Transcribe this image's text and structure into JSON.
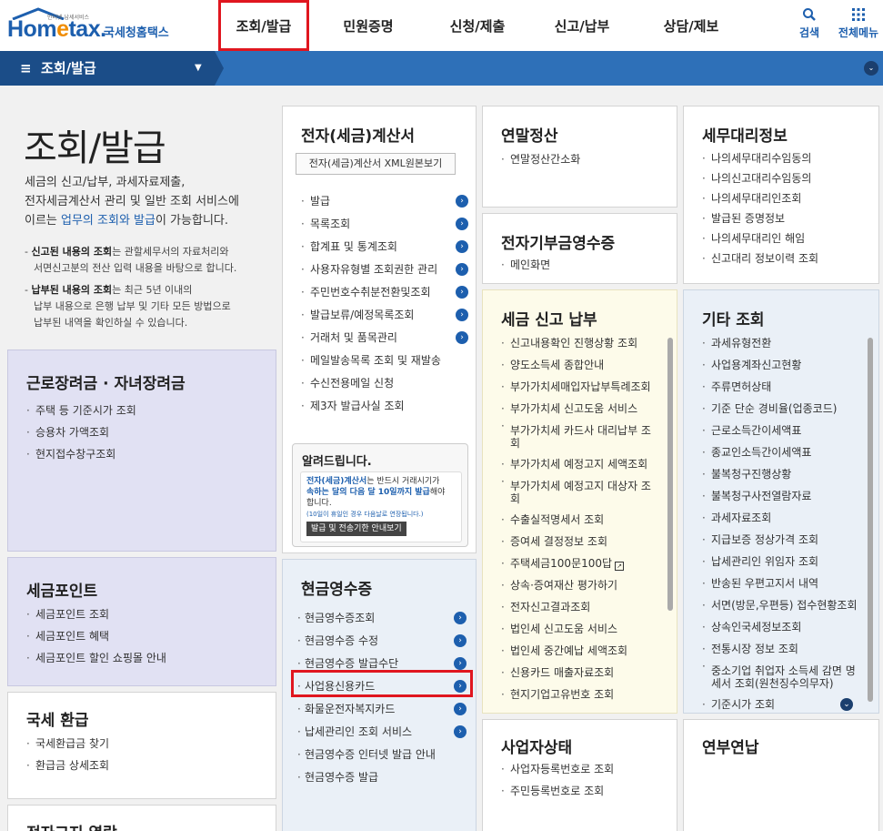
{
  "header": {
    "logo_tiny": "인터넷 납세서비스",
    "logo_word_a": "Hom",
    "logo_word_e": "e",
    "logo_word_b": "tax.",
    "logo_sub": "국세청홈택스",
    "gnb": [
      "조회/발급",
      "민원증명",
      "신청/제출",
      "신고/납부",
      "상담/제보"
    ],
    "search_label": "검색",
    "menu_label": "전체메뉴"
  },
  "navbar": {
    "title": "조회/발급",
    "menu_icon": "hamburger-icon"
  },
  "intro": {
    "title": "조회/발급",
    "desc_a": "세금의 신고/납부, 과세자료제출,",
    "desc_b": "전자세금계산서 관리 및 일반 조회 서비스에",
    "desc_c_pre": "이르는 ",
    "desc_c_hl": "업무의 조회와 발급",
    "desc_c_post": "이 가능합니다.",
    "note1_b": "신고된 내용의 조회",
    "note1_a": "는 관할세무서의 자료처리와",
    "note1_c": "서면신고분의 전산 입력 내용을 바탕으로 합니다.",
    "note2_b": "납부된 내용의 조회",
    "note2_a": "는 최근 5년 이내의",
    "note2_c": "납부 내용으로 은행 납부 및 기타 모든 방법으로",
    "note2_d": "납부된 내역을 확인하실 수 있습니다."
  },
  "cards": {
    "labor": {
      "title": "근로장려금 · 자녀장려금",
      "items": [
        "주택 등 기준시가 조회",
        "승용차 가액조회",
        "현지접수창구조회"
      ]
    },
    "point": {
      "title": "세금포인트",
      "items": [
        "세금포인트 조회",
        "세금포인트 혜택",
        "세금포인트 할인 쇼핑몰 안내"
      ]
    },
    "refund": {
      "title": "국세 환급",
      "items": [
        "국세환급금 찾기",
        "환급금 상세조회"
      ]
    },
    "notice_bottom": {
      "title": "전자고지 열람"
    },
    "einvoice": {
      "title": "전자(세금)계산서",
      "xml_button": "전자(세금)계산서 XML원본보기",
      "items": [
        "발급",
        "목록조회",
        "합계표 및 통계조회",
        "사용자유형별 조회권한 관리",
        "주민번호수취분전환및조회",
        "발급보류/예정목록조회",
        "거래처 및 품목관리",
        "메일발송목록 조회 및 재발송",
        "수신전용메일 신청",
        "제3자 발급사실 조회"
      ],
      "arrows": [
        true,
        true,
        true,
        true,
        true,
        true,
        true,
        false,
        false,
        false
      ]
    },
    "notice": {
      "title": "알려드립니다.",
      "text_a": "전자(세금)계산서",
      "text_b": "는 반드시 거래시기가",
      "text_c": "속하는 달의 다음 달 10일까지 발급",
      "text_d": "해야",
      "text_e": "합니다.",
      "text_small": "(10일이 휴일인 경우 다음날로 연장됩니다.)",
      "button": "발급 및 전송기한 안내보기"
    },
    "cash": {
      "title": "현금영수증",
      "items": [
        "현금영수증조회",
        "현금영수증 수정",
        "현금영수증 발급수단",
        "사업용신용카드",
        "화물운전자복지카드",
        "납세관리인 조회 서비스",
        "현금영수증 인터넷 발급 안내",
        "현금영수증 발급"
      ],
      "arrows": [
        true,
        true,
        true,
        true,
        true,
        true,
        false,
        false
      ]
    },
    "yearend": {
      "title": "연말정산",
      "items": [
        "연말정산간소화"
      ]
    },
    "donation": {
      "title": "전자기부금영수증",
      "items": [
        "메인화면"
      ]
    },
    "taxfile": {
      "title": "세금 신고 납부",
      "items": [
        "신고내용확인 진행상황 조회",
        "양도소득세 종합안내",
        "부가가치세매입자납부특례조회",
        "부가가치세 신고도움 서비스",
        "부가가치세 카드사 대리납부 조",
        "회",
        "부가가치세 예정고지 세액조회",
        "부가가치세 예정고지 대상자 조",
        "회",
        "수출실적명세서 조회",
        "증여세 결정정보 조회",
        "주택세금100문100답",
        "상속·증여재산 평가하기",
        "전자신고결과조회",
        "법인세 신고도움 서비스",
        "법인세 중간예납 세액조회",
        "신용카드 매출자료조회",
        "현지기업고유번호 조회"
      ]
    },
    "bizstatus": {
      "title": "사업자상태",
      "items": [
        "사업자등록번호로 조회",
        "주민등록번호로 조회"
      ]
    },
    "agent": {
      "title": "세무대리정보",
      "items": [
        "나의세무대리수임동의",
        "나의신고대리수임동의",
        "나의세무대리인조회",
        "발급된 증명정보",
        "나의세무대리인 해임",
        "신고대리 정보이력 조회"
      ]
    },
    "etc": {
      "title": "기타 조회",
      "items": [
        "과세유형전환",
        "사업용계좌신고현황",
        "주류면허상태",
        "기준 단순 경비율(업종코드)",
        "근로소득간이세액표",
        "종교인소득간이세액표",
        "불복청구진행상황",
        "불복청구사전열람자료",
        "과세자료조회",
        "지급보증 정상가격 조회",
        "납세관리인 위임자 조회",
        "반송된 우편고지서 내역",
        "서면(방문,우편등) 접수현황조회",
        "상속인국세정보조회",
        "전통시장 정보 조회",
        "중소기업 취업자 소득세 감면 명",
        "세서 조회(원천징수의무자)",
        "기준시가 조회"
      ]
    },
    "pension": {
      "title": "연부연납"
    }
  }
}
